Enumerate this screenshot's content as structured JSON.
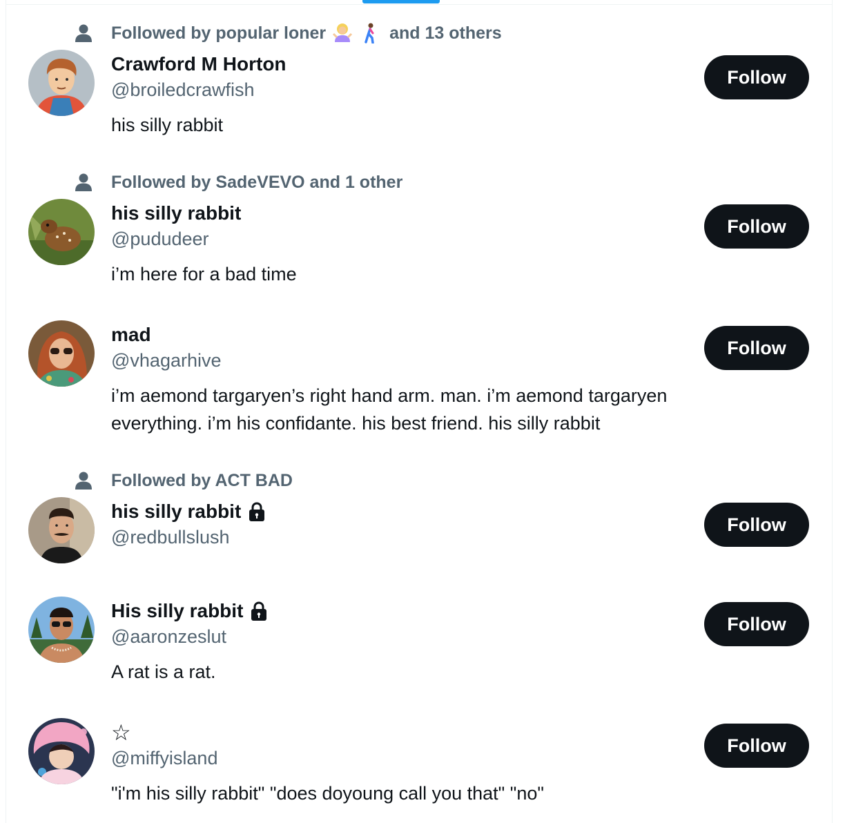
{
  "users": [
    {
      "social_context": "Followed by popular loner",
      "social_suffix": "and 13 others",
      "name": "Crawford M Horton",
      "handle": "@broiledcrawfish",
      "bio": "his silly rabbit",
      "follow_label": "Follow",
      "avatar": "cartoon-man-avatar"
    },
    {
      "social_context": "Followed by SadeVEVO and 1 other",
      "name": "his silly rabbit",
      "handle": "@pududeer",
      "bio": "i’m here for a bad time",
      "follow_label": "Follow",
      "avatar": "fawn-avatar"
    },
    {
      "name": "mad",
      "handle": "@vhagarhive",
      "bio": "i’m aemond targaryen’s right hand arm. man. i’m aemond targaryen everything. i’m his confidante. his best friend. his silly rabbit",
      "follow_label": "Follow",
      "avatar": "redhead-sunglasses-avatar"
    },
    {
      "social_context": "Followed by ACT BAD",
      "name": "his silly rabbit",
      "handle": "@redbullslush",
      "bio": "",
      "follow_label": "Follow",
      "protected": true,
      "avatar": "mustache-man-avatar"
    },
    {
      "name": "His silly rabbit",
      "handle": "@aaronzeslut",
      "bio": "A rat is a rat.",
      "follow_label": "Follow",
      "protected": true,
      "avatar": "beach-sunglasses-avatar"
    },
    {
      "name": "☆",
      "handle": "@miffyisland",
      "bio": "\"i'm his silly rabbit\" \"does doyoung call you that\" \"no\"",
      "follow_label": "Follow",
      "avatar": "pink-hat-avatar"
    }
  ],
  "colors": {
    "text_primary": "#0f1419",
    "text_secondary": "#536471",
    "button_bg": "#0f1419",
    "button_text": "#ffffff",
    "accent": "#1d9bf0"
  }
}
